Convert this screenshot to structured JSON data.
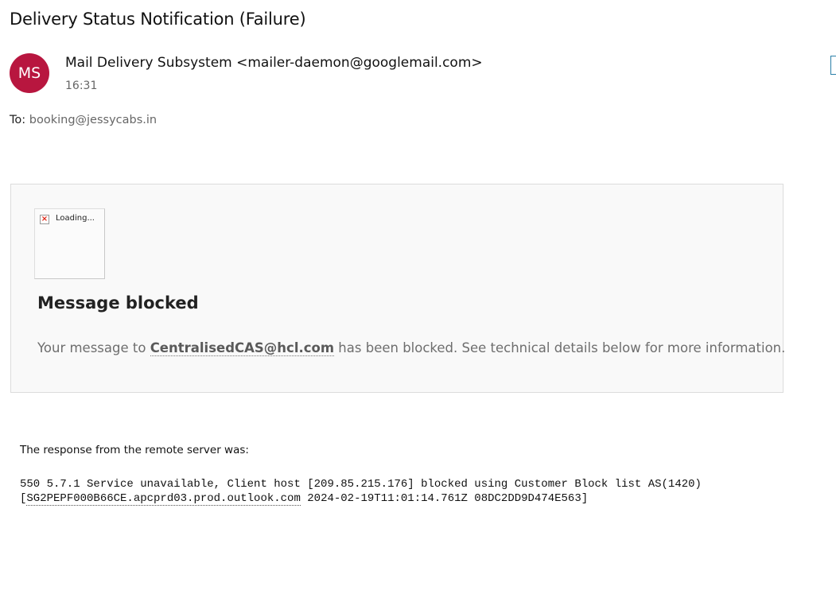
{
  "email": {
    "subject": "Delivery Status Notification (Failure)",
    "avatar_initials": "MS",
    "avatar_color": "#b8163f",
    "sender": "Mail Delivery Subsystem <mailer-daemon@googlemail.com>",
    "time": "16:31",
    "to_label": "To:",
    "to_address": "booking@jessycabs.in"
  },
  "card": {
    "image_alt": "Loading...",
    "title": "Message blocked",
    "msg_prefix": "Your message to ",
    "msg_email": "CentralisedCAS@hcl.com",
    "msg_suffix": " has been blocked. See technical details below for more information."
  },
  "response": {
    "label": "The response from the remote server was:",
    "line1": "550 5.7.1 Service unavailable, Client host [209.85.215.176] blocked using Customer Block list AS(1420)",
    "line2_open": "[",
    "line2_host": "SG2PEPF000B66CE.apcprd03.prod.outlook.com",
    "line2_rest": " 2024-02-19T11:01:14.761Z 08DC2DD9D474E563]"
  }
}
